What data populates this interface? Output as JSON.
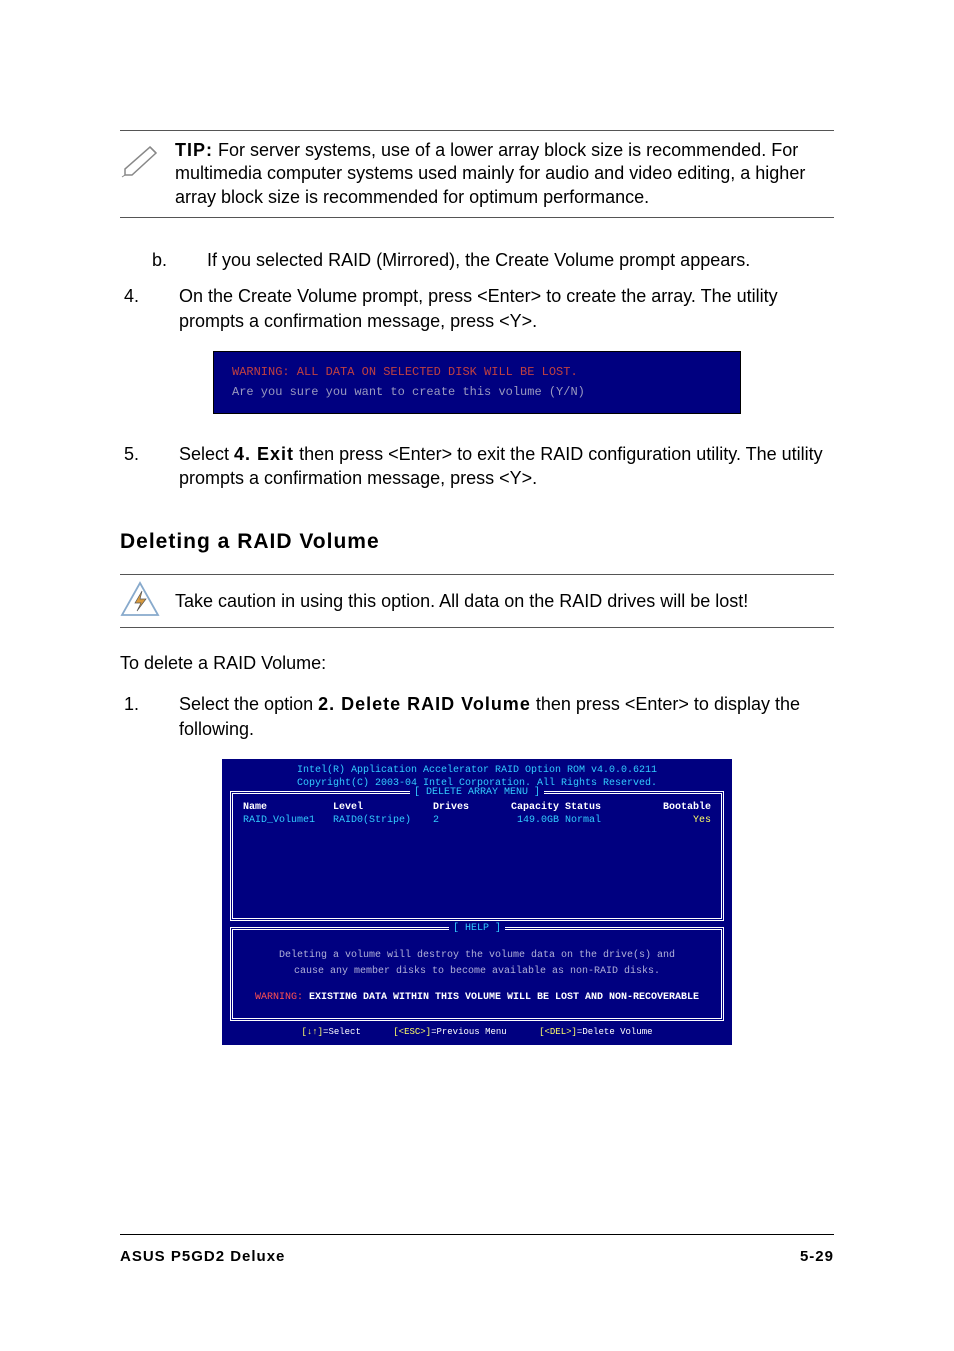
{
  "tip": {
    "label": "TIP:",
    "text": "For server systems, use of a lower array block size is recommended. For multimedia computer systems used mainly for audio and video editing, a higher array block size is recommended for optimum performance."
  },
  "step_b": {
    "marker": "b.",
    "text": "If you selected RAID (Mirrored), the Create Volume prompt appears."
  },
  "step_4": {
    "marker": "4.",
    "text": "On the Create Volume prompt, press <Enter> to create the array. The utility prompts a confirmation message, press <Y>."
  },
  "console1": {
    "warning": "WARNING:  ALL DATA ON SELECTED DISK WILL BE LOST.",
    "prompt": "Are you sure you want to create this volume (Y/N)"
  },
  "step_5": {
    "marker": "5.",
    "pre": "Select ",
    "bold": "4. Exit",
    "post": " then press <Enter> to exit the RAID configuration utility. The utility prompts a confirmation message, press <Y>."
  },
  "heading2": "Deleting a RAID Volume",
  "caution": "Take caution in using this option. All data on the RAID drives will be lost!",
  "delete_intro": "To delete a RAID Volume:",
  "step_d1": {
    "marker": "1.",
    "pre": "Select the option ",
    "bold": "2. Delete RAID Volume",
    "post": " then press <Enter> to display the following."
  },
  "bios": {
    "head1": "Intel(R) Application Accelerator RAID Option ROM v4.0.0.6211",
    "head2": "Copyright(C) 2003-04 Intel Corporation. All Rights Reserved.",
    "frame1_title": "[ DELETE ARRAY MENU ]",
    "cols": {
      "name": "Name",
      "level": "Level",
      "drives": "Drives",
      "capacity": "Capacity",
      "status": "Status",
      "bootable": "Bootable"
    },
    "row": {
      "name": "RAID_Volume1",
      "level": "RAID0(Stripe)",
      "drives": "2",
      "capacity": "149.0GB",
      "status": "Normal",
      "bootable": "Yes"
    },
    "frame2_title": "[ HELP ]",
    "help1": "Deleting a volume will destroy the volume data on the drive(s) and",
    "help2": "cause any member disks to become available as non-RAID disks.",
    "warn_label": "WARNING:",
    "warn_text": " EXISTING DATA WITHIN THIS VOLUME WILL BE LOST AND NON-RECOVERABLE",
    "footer": {
      "sel_k": "[↓↑]",
      "sel_t": "=Select",
      "esc_k": "[<ESC>]",
      "esc_t": "=Previous Menu",
      "del_k": "[<DEL>]",
      "del_t": "=Delete Volume"
    }
  },
  "footer": {
    "left": "ASUS P5GD2 Deluxe",
    "right": "5-29"
  }
}
